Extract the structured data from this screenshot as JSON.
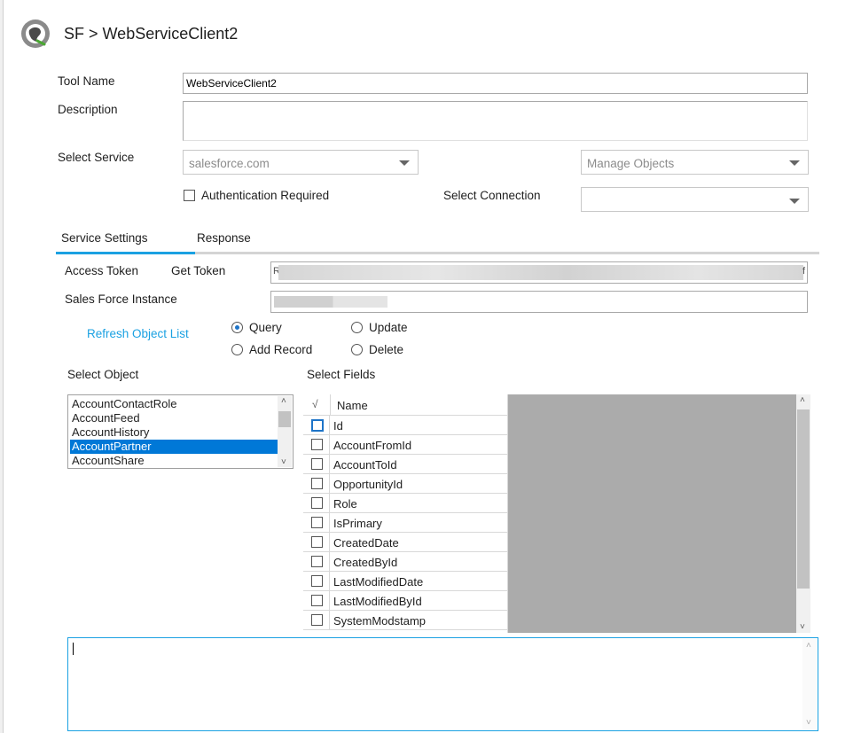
{
  "header": {
    "breadcrumb": "SF > WebServiceClient2"
  },
  "form": {
    "tool_name_label": "Tool Name",
    "tool_name_value": "WebServiceClient2",
    "description_label": "Description",
    "description_value": "",
    "select_service_label": "Select Service",
    "service_value": "salesforce.com",
    "manage_objects_value": "Manage Objects",
    "auth_required_label": "Authentication Required",
    "select_connection_label": "Select Connection",
    "connection_value": ""
  },
  "tabs": [
    {
      "label": "Service Settings",
      "active": true
    },
    {
      "label": "Response",
      "active": false
    }
  ],
  "settings": {
    "access_token_label": "Access Token",
    "get_token_label": "Get Token",
    "access_token_prefix": "R",
    "access_token_suffix": "f",
    "instance_label": "Sales Force Instance",
    "refresh_link": "Refresh Object List",
    "operations": [
      {
        "label": "Query",
        "selected": true
      },
      {
        "label": "Update",
        "selected": false
      },
      {
        "label": "Add Record",
        "selected": false
      },
      {
        "label": "Delete",
        "selected": false
      }
    ],
    "select_object_label": "Select Object",
    "select_fields_label": "Select Fields",
    "objects": [
      "AccountContactRole",
      "AccountFeed",
      "AccountHistory",
      "AccountPartner",
      "AccountShare"
    ],
    "selected_object": "AccountPartner",
    "fields_header_check": "√",
    "fields_header_name": "Name",
    "fields": [
      "Id",
      "AccountFromId",
      "AccountToId",
      "OpportunityId",
      "Role",
      "IsPrimary",
      "CreatedDate",
      "CreatedById",
      "LastModifiedDate",
      "LastModifiedById",
      "SystemModstamp"
    ]
  },
  "query_box": {
    "value": ""
  }
}
